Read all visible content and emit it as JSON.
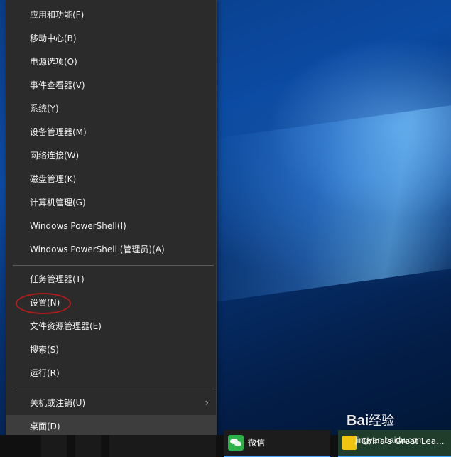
{
  "menu": {
    "items": [
      {
        "label": "应用和功能(F)"
      },
      {
        "label": "移动中心(B)"
      },
      {
        "label": "电源选项(O)"
      },
      {
        "label": "事件查看器(V)"
      },
      {
        "label": "系统(Y)"
      },
      {
        "label": "设备管理器(M)"
      },
      {
        "label": "网络连接(W)"
      },
      {
        "label": "磁盘管理(K)"
      },
      {
        "label": "计算机管理(G)"
      },
      {
        "label": "Windows PowerShell(I)"
      },
      {
        "label": "Windows PowerShell (管理员)(A)"
      },
      {
        "label": "任务管理器(T)"
      },
      {
        "label": "设置(N)"
      },
      {
        "label": "文件资源管理器(E)"
      },
      {
        "label": "搜索(S)"
      },
      {
        "label": "运行(R)"
      },
      {
        "label": "关机或注销(U)"
      },
      {
        "label": "桌面(D)"
      }
    ],
    "submenu_arrow": "›"
  },
  "taskbar": {
    "wechat_label": "微信",
    "media_label": "China's Great Lea..."
  },
  "watermark": {
    "brand": "Bai",
    "brand_rest": "经验",
    "url": "jingyan.baidu.com"
  },
  "colors": {
    "menu_bg": "#2b2b2b",
    "highlight_circle": "#b01b1b",
    "taskbar_accent": "#4aa3ff"
  }
}
